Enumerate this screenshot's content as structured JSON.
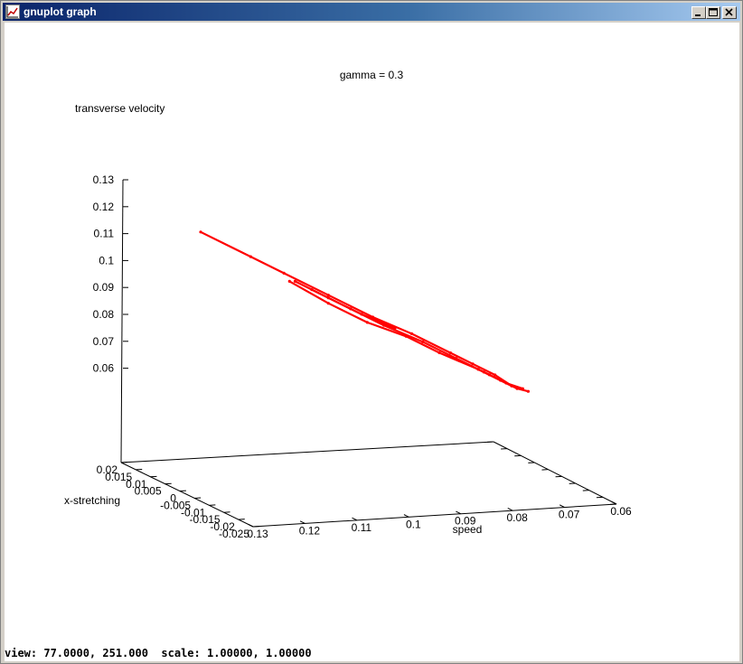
{
  "window": {
    "title": "gnuplot graph"
  },
  "status_bar": {
    "text": "view: 77.0000, 251.000  scale: 1.00000, 1.00000"
  },
  "colors": {
    "series": "#ff0000",
    "axes": "#000000",
    "background": "#ffffff"
  },
  "chart_data": {
    "type": "scatter",
    "title": "gamma = 0.3",
    "xlabel": "speed",
    "ylabel": "x-stretching",
    "zlabel": "transverse velocity",
    "xlim": [
      0.06,
      0.13
    ],
    "ylim": [
      -0.025,
      0.02
    ],
    "zlim": [
      0.05,
      0.13
    ],
    "x_ticks": [
      "0.13",
      "0.12",
      "0.11",
      "0.1",
      "0.09",
      "0.08",
      "0.07",
      "0.06"
    ],
    "y_ticks": [
      "0.02",
      "0.015",
      "0.01",
      "0.005",
      "0",
      "-0.005",
      "-0.01",
      "-0.015",
      "-0.02",
      "-0.025"
    ],
    "z_ticks": [
      "0.13",
      "0.12",
      "0.11",
      "0.1",
      "0.09",
      "0.08",
      "0.07",
      "0.06"
    ],
    "grid": false,
    "legend": "none",
    "series": [
      {
        "segments": [
          [
            [
              0.127,
              0.118
            ],
            [
              0.118,
              0.109
            ],
            [
              0.112,
              0.103
            ],
            [
              0.104,
              0.095
            ],
            [
              0.096,
              0.087
            ],
            [
              0.089,
              0.081
            ],
            [
              0.082,
              0.074
            ],
            [
              0.078,
              0.07
            ],
            [
              0.074,
              0.066
            ],
            [
              0.071,
              0.062
            ]
          ],
          [
            [
              0.11,
              0.1
            ],
            [
              0.104,
              0.094
            ],
            [
              0.098,
              0.088
            ],
            [
              0.092,
              0.083
            ]
          ],
          [
            [
              0.111,
              0.1
            ],
            [
              0.104,
              0.092
            ],
            [
              0.097,
              0.085
            ],
            [
              0.09,
              0.08
            ],
            [
              0.084,
              0.074
            ],
            [
              0.077,
              0.068
            ],
            [
              0.072,
              0.063
            ],
            [
              0.069,
              0.061
            ]
          ],
          [
            [
              0.107,
              0.097
            ],
            [
              0.1,
              0.09
            ],
            [
              0.094,
              0.084
            ],
            [
              0.087,
              0.078
            ],
            [
              0.081,
              0.072
            ],
            [
              0.076,
              0.067
            ],
            [
              0.071,
              0.062
            ]
          ],
          [
            [
              0.077,
              0.068
            ],
            [
              0.075,
              0.066
            ],
            [
              0.073,
              0.064
            ],
            [
              0.07,
              0.061
            ],
            [
              0.068,
              0.06
            ]
          ]
        ]
      }
    ]
  }
}
